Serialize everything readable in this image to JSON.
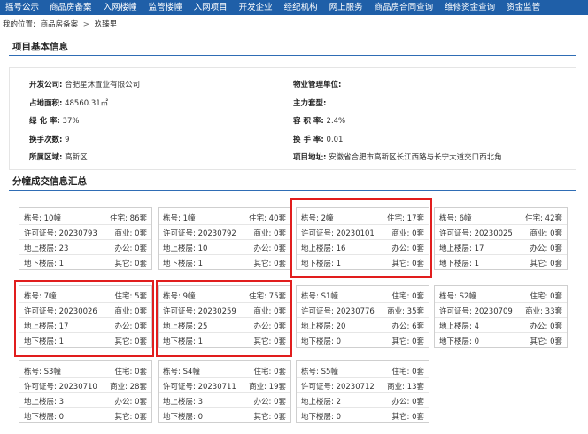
{
  "nav": [
    "摇号公示",
    "商品房备案",
    "入网楼幢",
    "监管楼幢",
    "入网项目",
    "开发企业",
    "经纪机构",
    "网上服务",
    "商品房合同查询",
    "维修资金查询",
    "资金监管"
  ],
  "breadcrumb": {
    "prefix": "我的位置:",
    "level1": "商品房备案",
    "sep": ">",
    "level2": "玖臻里"
  },
  "section1": "项目基本信息",
  "info": {
    "dev_label": "开发公司:",
    "dev_value": "合肥星沐置业有限公司",
    "area_label": "占地面积:",
    "area_value": "48560.31㎡",
    "green_label": "绿 化 率:",
    "green_value": "37%",
    "transfer_label": "换手次数:",
    "transfer_value": "9",
    "district_label": "所属区域:",
    "district_value": "高新区",
    "mgmt_label": "物业管理单位:",
    "mgmt_value": "",
    "type_label": "主力套型:",
    "type_value": "",
    "far_label": "容 积 率:",
    "far_value": "2.4%",
    "turnover_label": "换 手 率:",
    "turnover_value": "0.01",
    "addr_label": "项目地址:",
    "addr_value": "安徽省合肥市高新区长江西路与长宁大道交口西北角"
  },
  "section2": "分幢成交信息汇总",
  "labels": {
    "bldg": "栋号:",
    "res": "住宅:",
    "permit": "许可证号:",
    "biz": "商业:",
    "above": "地上楼层:",
    "office": "办公:",
    "below": "地下楼层:",
    "other": "其它:"
  },
  "cards": [
    {
      "bldg": "10幢",
      "res": "86套",
      "permit": "20230793",
      "biz": "0套",
      "above": "23",
      "office": "0套",
      "below": "1",
      "other": "0套"
    },
    {
      "bldg": "1幢",
      "res": "40套",
      "permit": "20230792",
      "biz": "0套",
      "above": "10",
      "office": "0套",
      "below": "1",
      "other": "0套"
    },
    {
      "bldg": "2幢",
      "res": "17套",
      "permit": "20230101",
      "biz": "0套",
      "above": "16",
      "office": "0套",
      "below": "1",
      "other": "0套"
    },
    {
      "bldg": "6幢",
      "res": "42套",
      "permit": "20230025",
      "biz": "0套",
      "above": "17",
      "office": "0套",
      "below": "1",
      "other": "0套"
    },
    {
      "bldg": "7幢",
      "res": "5套",
      "permit": "20230026",
      "biz": "0套",
      "above": "17",
      "office": "0套",
      "below": "1",
      "other": "0套"
    },
    {
      "bldg": "9幢",
      "res": "75套",
      "permit": "20230259",
      "biz": "0套",
      "above": "25",
      "office": "0套",
      "below": "1",
      "other": "0套"
    },
    {
      "bldg": "S1幢",
      "res": "0套",
      "permit": "20230776",
      "biz": "35套",
      "above": "20",
      "office": "6套",
      "below": "0",
      "other": "0套"
    },
    {
      "bldg": "S2幢",
      "res": "0套",
      "permit": "20230709",
      "biz": "33套",
      "above": "4",
      "office": "0套",
      "below": "0",
      "other": "0套"
    },
    {
      "bldg": "S3幢",
      "res": "0套",
      "permit": "20230710",
      "biz": "28套",
      "above": "3",
      "office": "0套",
      "below": "0",
      "other": "0套"
    },
    {
      "bldg": "S4幢",
      "res": "0套",
      "permit": "20230711",
      "biz": "19套",
      "above": "3",
      "office": "0套",
      "below": "0",
      "other": "0套"
    },
    {
      "bldg": "S5幢",
      "res": "0套",
      "permit": "20230712",
      "biz": "13套",
      "above": "2",
      "office": "0套",
      "below": "0",
      "other": "0套"
    }
  ],
  "highlight_color": "#e11d1d"
}
